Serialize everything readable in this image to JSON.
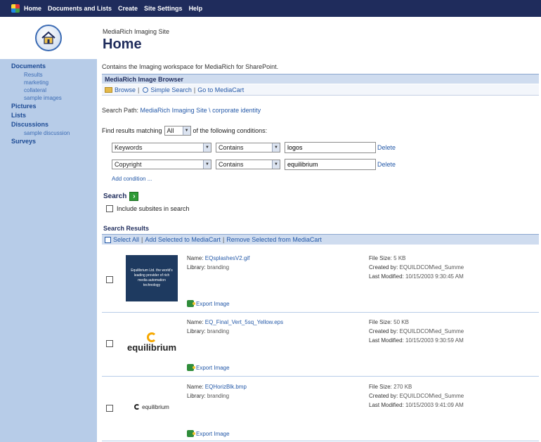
{
  "topnav": [
    "Home",
    "Documents and Lists",
    "Create",
    "Site Settings",
    "Help"
  ],
  "site_name": "MediaRich Imaging Site",
  "page_title": "Home",
  "sidebar": [
    {
      "label": "Documents",
      "type": "heading"
    },
    {
      "label": "Results",
      "type": "sub"
    },
    {
      "label": "marketing",
      "type": "sub"
    },
    {
      "label": "collateral",
      "type": "sub"
    },
    {
      "label": "sample images",
      "type": "sub"
    },
    {
      "label": "Pictures",
      "type": "heading"
    },
    {
      "label": "Lists",
      "type": "heading"
    },
    {
      "label": "Discussions",
      "type": "heading"
    },
    {
      "label": "sample discussion",
      "type": "sub"
    },
    {
      "label": "Surveys",
      "type": "heading"
    }
  ],
  "description": "Contains the Imaging workspace for MediaRich for SharePoint.",
  "browser": {
    "title": "MediaRich Image Browser",
    "toolbar": {
      "browse": "Browse",
      "simple_search": "Simple Search",
      "go_to_cart": "Go to MediaCart",
      "sep": "|"
    }
  },
  "search_path": {
    "label": "Search Path:",
    "value": "MediaRich Imaging Site \\ corporate identity"
  },
  "find": {
    "prefix": "Find results matching",
    "match": "All",
    "suffix": "of the following conditions:"
  },
  "conditions": [
    {
      "field": "Keywords",
      "operator": "Contains",
      "value": "logos",
      "delete": "Delete"
    },
    {
      "field": "Copyright",
      "operator": "Contains",
      "value": "equilibrium",
      "delete": "Delete"
    }
  ],
  "add_condition": "Add condition ...",
  "search": {
    "label": "Search",
    "go": "›",
    "include_subsites": "Include subsites in search"
  },
  "results": {
    "title": "Search Results",
    "toolbar": {
      "select_all": "Select All",
      "add_selected": "Add Selected to MediaCart",
      "remove_selected": "Remove Selected from MediaCart",
      "sep": "|"
    },
    "labels": {
      "name": "Name:",
      "library": "Library:",
      "file_size": "File Size:",
      "created_by": "Created by:",
      "last_modified": "Last Modified:",
      "export": "Export Image"
    },
    "items": [
      {
        "name": "EQsplashesV2.gif",
        "library": "branding",
        "file_size": "5 KB",
        "created_by": "EQUILDCOM\\ed_Summe",
        "last_modified": "10/15/2003 9:30:45 AM",
        "thumb_text": "Equilibrium Ltd. the world's leading provider of rich media automation technology"
      },
      {
        "name": "EQ_Final_Vert_5sq_Yellow.eps",
        "library": "branding",
        "file_size": "50 KB",
        "created_by": "EQUILDCOM\\ed_Summe",
        "last_modified": "10/15/2003 9:30:59 AM",
        "thumb_text": "equilibrium"
      },
      {
        "name": "EQHorizBlk.bmp",
        "library": "branding",
        "file_size": "270 KB",
        "created_by": "EQUILDCOM\\ed_Summe",
        "last_modified": "10/15/2003 9:41:09 AM",
        "thumb_text": "equilibrium"
      }
    ]
  }
}
